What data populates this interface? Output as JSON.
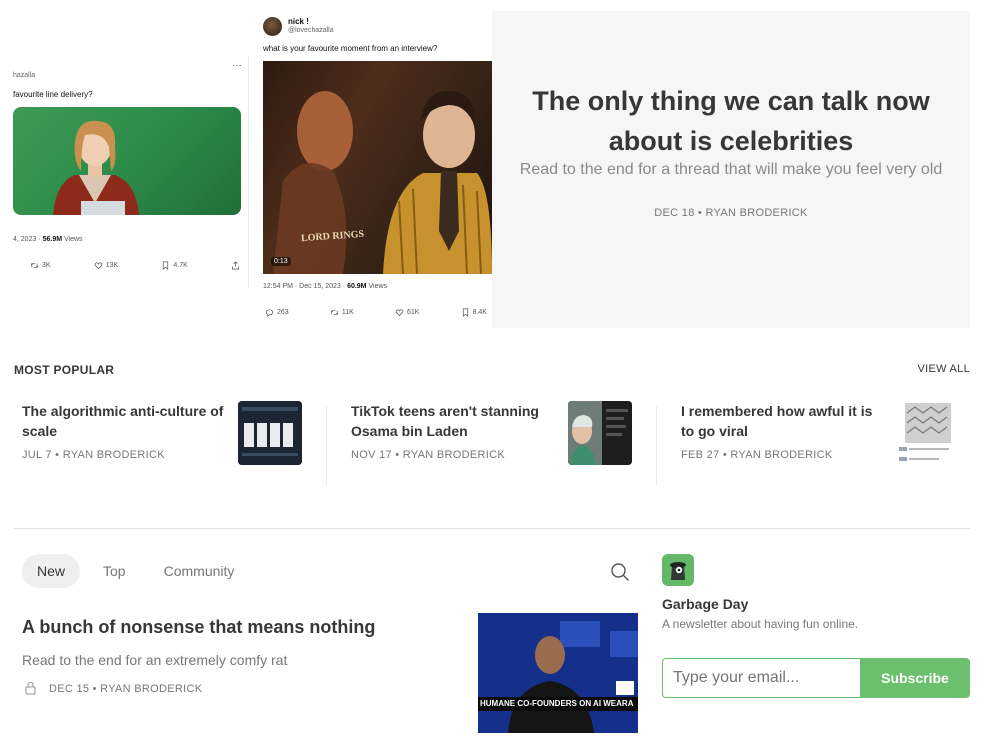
{
  "hero": {
    "tweet_left": {
      "handle": "hazalla",
      "text": "favourite line delivery?",
      "date": "4, 2023 ·",
      "views": "56.9M",
      "views_label": "Views",
      "retweets": "3K",
      "likes": "13K",
      "bookmarks": "4.7K"
    },
    "tweet_right": {
      "name": "nick !",
      "handle": "@lovechazalla",
      "text": "what is your favourite moment from an interview?",
      "video_caption": "LORD RINGS",
      "timecode": "0:13",
      "timestamp": "12:54 PM · Dec 15, 2023 ·",
      "views": "60.9M",
      "views_label": "Views",
      "replies": "263",
      "retweets": "11K",
      "likes": "61K",
      "bookmarks": "8.4K"
    },
    "card": {
      "title": "The only thing we can talk now about is celebrities",
      "subtitle": "Read to the end for a thread that will make you feel very old",
      "meta": "DEC 18 • RYAN BRODERICK"
    }
  },
  "popular": {
    "title": "MOST POPULAR",
    "view_all": "VIEW ALL",
    "items": [
      {
        "title": "The algorithmic anti-culture of scale",
        "meta": "JUL 7 • RYAN BRODERICK"
      },
      {
        "title": "TikTok teens aren't stanning Osama bin Laden",
        "meta": "NOV 17 • RYAN BRODERICK"
      },
      {
        "title": "I remembered how awful it is to go viral",
        "meta": "FEB 27 • RYAN BRODERICK"
      }
    ]
  },
  "feed": {
    "tabs": [
      "New",
      "Top",
      "Community"
    ],
    "active_tab": "New",
    "post": {
      "title": "A bunch of nonsense that means nothing",
      "subtitle": "Read to the end for an extremely comfy rat",
      "meta": "DEC 15 • RYAN BRODERICK",
      "thumb_chyron": "HUMANE CO-FOUNDERS ON AI WEARA"
    }
  },
  "newsletter": {
    "name": "Garbage Day",
    "description": "A newsletter about having fun online.",
    "email_placeholder": "Type your email...",
    "subscribe_label": "Subscribe"
  },
  "colors": {
    "text": "#363737",
    "muted": "#777777",
    "accent": "#6cbf6c",
    "hero_bg": "#f6f6f6"
  },
  "icons": [
    "retweet-icon",
    "heart-icon",
    "bookmark-icon",
    "share-icon",
    "reply-icon",
    "search-icon",
    "lock-icon"
  ]
}
